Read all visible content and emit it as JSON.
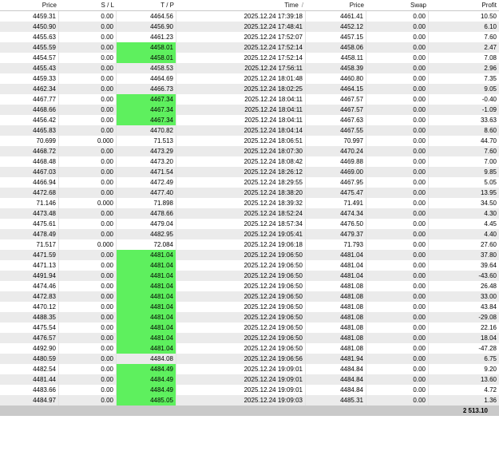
{
  "headers": {
    "price_open": "Price",
    "sl": "S / L",
    "tp": "T / P",
    "time": "Time",
    "time_sort": "/",
    "price_cur": "Price",
    "swap": "Swap",
    "profit": "Profit"
  },
  "rows": [
    {
      "p1": "4459.31",
      "sl": "0.00",
      "tp": "4464.56",
      "hl": false,
      "time": "2025.12.24 17:39:18",
      "p2": "4461.41",
      "swap": "0.00",
      "profit": "10.50"
    },
    {
      "p1": "4450.90",
      "sl": "0.00",
      "tp": "4456.90",
      "hl": false,
      "time": "2025.12.24 17:48:41",
      "p2": "4452.12",
      "swap": "0.00",
      "profit": "6.10"
    },
    {
      "p1": "4455.63",
      "sl": "0.00",
      "tp": "4461.23",
      "hl": false,
      "time": "2025.12.24 17:52:07",
      "p2": "4457.15",
      "swap": "0.00",
      "profit": "7.60"
    },
    {
      "p1": "4455.59",
      "sl": "0.00",
      "tp": "4458.01",
      "hl": true,
      "time": "2025.12.24 17:52:14",
      "p2": "4458.06",
      "swap": "0.00",
      "profit": "2.47"
    },
    {
      "p1": "4454.57",
      "sl": "0.00",
      "tp": "4458.01",
      "hl": true,
      "time": "2025.12.24 17:52:14",
      "p2": "4458.11",
      "swap": "0.00",
      "profit": "7.08"
    },
    {
      "p1": "4455.43",
      "sl": "0.00",
      "tp": "4458.53",
      "hl": false,
      "time": "2025.12.24 17:56:11",
      "p2": "4458.39",
      "swap": "0.00",
      "profit": "2.96"
    },
    {
      "p1": "4459.33",
      "sl": "0.00",
      "tp": "4464.69",
      "hl": false,
      "time": "2025.12.24 18:01:48",
      "p2": "4460.80",
      "swap": "0.00",
      "profit": "7.35"
    },
    {
      "p1": "4462.34",
      "sl": "0.00",
      "tp": "4466.73",
      "hl": false,
      "time": "2025.12.24 18:02:25",
      "p2": "4464.15",
      "swap": "0.00",
      "profit": "9.05"
    },
    {
      "p1": "4467.77",
      "sl": "0.00",
      "tp": "4467.34",
      "hl": true,
      "time": "2025.12.24 18:04:11",
      "p2": "4467.57",
      "swap": "0.00",
      "profit": "-0.40"
    },
    {
      "p1": "4468.66",
      "sl": "0.00",
      "tp": "4467.34",
      "hl": true,
      "time": "2025.12.24 18:04:11",
      "p2": "4467.57",
      "swap": "0.00",
      "profit": "-1.09"
    },
    {
      "p1": "4456.42",
      "sl": "0.00",
      "tp": "4467.34",
      "hl": true,
      "time": "2025.12.24 18:04:11",
      "p2": "4467.63",
      "swap": "0.00",
      "profit": "33.63"
    },
    {
      "p1": "4465.83",
      "sl": "0.00",
      "tp": "4470.82",
      "hl": false,
      "time": "2025.12.24 18:04:14",
      "p2": "4467.55",
      "swap": "0.00",
      "profit": "8.60"
    },
    {
      "p1": "70.699",
      "sl": "0.000",
      "tp": "71.513",
      "hl": false,
      "time": "2025.12.24 18:06:51",
      "p2": "70.997",
      "swap": "0.00",
      "profit": "44.70"
    },
    {
      "p1": "4468.72",
      "sl": "0.00",
      "tp": "4473.29",
      "hl": false,
      "time": "2025.12.24 18:07:30",
      "p2": "4470.24",
      "swap": "0.00",
      "profit": "7.60"
    },
    {
      "p1": "4468.48",
      "sl": "0.00",
      "tp": "4473.20",
      "hl": false,
      "time": "2025.12.24 18:08:42",
      "p2": "4469.88",
      "swap": "0.00",
      "profit": "7.00"
    },
    {
      "p1": "4467.03",
      "sl": "0.00",
      "tp": "4471.54",
      "hl": false,
      "time": "2025.12.24 18:26:12",
      "p2": "4469.00",
      "swap": "0.00",
      "profit": "9.85"
    },
    {
      "p1": "4466.94",
      "sl": "0.00",
      "tp": "4472.49",
      "hl": false,
      "time": "2025.12.24 18:29:55",
      "p2": "4467.95",
      "swap": "0.00",
      "profit": "5.05"
    },
    {
      "p1": "4472.68",
      "sl": "0.00",
      "tp": "4477.40",
      "hl": false,
      "time": "2025.12.24 18:38:20",
      "p2": "4475.47",
      "swap": "0.00",
      "profit": "13.95"
    },
    {
      "p1": "71.146",
      "sl": "0.000",
      "tp": "71.898",
      "hl": false,
      "time": "2025.12.24 18:39:32",
      "p2": "71.491",
      "swap": "0.00",
      "profit": "34.50"
    },
    {
      "p1": "4473.48",
      "sl": "0.00",
      "tp": "4478.66",
      "hl": false,
      "time": "2025.12.24 18:52:24",
      "p2": "4474.34",
      "swap": "0.00",
      "profit": "4.30"
    },
    {
      "p1": "4475.61",
      "sl": "0.00",
      "tp": "4479.04",
      "hl": false,
      "time": "2025.12.24 18:57:34",
      "p2": "4476.50",
      "swap": "0.00",
      "profit": "4.45"
    },
    {
      "p1": "4478.49",
      "sl": "0.00",
      "tp": "4482.95",
      "hl": false,
      "time": "2025.12.24 19:05:41",
      "p2": "4479.37",
      "swap": "0.00",
      "profit": "4.40"
    },
    {
      "p1": "71.517",
      "sl": "0.000",
      "tp": "72.084",
      "hl": false,
      "time": "2025.12.24 19:06:18",
      "p2": "71.793",
      "swap": "0.00",
      "profit": "27.60"
    },
    {
      "p1": "4471.59",
      "sl": "0.00",
      "tp": "4481.04",
      "hl": true,
      "time": "2025.12.24 19:06:50",
      "p2": "4481.04",
      "swap": "0.00",
      "profit": "37.80"
    },
    {
      "p1": "4471.13",
      "sl": "0.00",
      "tp": "4481.04",
      "hl": true,
      "time": "2025.12.24 19:06:50",
      "p2": "4481.04",
      "swap": "0.00",
      "profit": "39.64"
    },
    {
      "p1": "4491.94",
      "sl": "0.00",
      "tp": "4481.04",
      "hl": true,
      "time": "2025.12.24 19:06:50",
      "p2": "4481.04",
      "swap": "0.00",
      "profit": "-43.60"
    },
    {
      "p1": "4474.46",
      "sl": "0.00",
      "tp": "4481.04",
      "hl": true,
      "time": "2025.12.24 19:06:50",
      "p2": "4481.08",
      "swap": "0.00",
      "profit": "26.48"
    },
    {
      "p1": "4472.83",
      "sl": "0.00",
      "tp": "4481.04",
      "hl": true,
      "time": "2025.12.24 19:06:50",
      "p2": "4481.08",
      "swap": "0.00",
      "profit": "33.00"
    },
    {
      "p1": "4470.12",
      "sl": "0.00",
      "tp": "4481.04",
      "hl": true,
      "time": "2025.12.24 19:06:50",
      "p2": "4481.08",
      "swap": "0.00",
      "profit": "43.84"
    },
    {
      "p1": "4488.35",
      "sl": "0.00",
      "tp": "4481.04",
      "hl": true,
      "time": "2025.12.24 19:06:50",
      "p2": "4481.08",
      "swap": "0.00",
      "profit": "-29.08"
    },
    {
      "p1": "4475.54",
      "sl": "0.00",
      "tp": "4481.04",
      "hl": true,
      "time": "2025.12.24 19:06:50",
      "p2": "4481.08",
      "swap": "0.00",
      "profit": "22.16"
    },
    {
      "p1": "4476.57",
      "sl": "0.00",
      "tp": "4481.04",
      "hl": true,
      "time": "2025.12.24 19:06:50",
      "p2": "4481.08",
      "swap": "0.00",
      "profit": "18.04"
    },
    {
      "p1": "4492.90",
      "sl": "0.00",
      "tp": "4481.04",
      "hl": true,
      "time": "2025.12.24 19:06:50",
      "p2": "4481.08",
      "swap": "0.00",
      "profit": "-47.28"
    },
    {
      "p1": "4480.59",
      "sl": "0.00",
      "tp": "4484.08",
      "hl": false,
      "time": "2025.12.24 19:06:56",
      "p2": "4481.94",
      "swap": "0.00",
      "profit": "6.75"
    },
    {
      "p1": "4482.54",
      "sl": "0.00",
      "tp": "4484.49",
      "hl": true,
      "time": "2025.12.24 19:09:01",
      "p2": "4484.84",
      "swap": "0.00",
      "profit": "9.20"
    },
    {
      "p1": "4481.44",
      "sl": "0.00",
      "tp": "4484.49",
      "hl": true,
      "time": "2025.12.24 19:09:01",
      "p2": "4484.84",
      "swap": "0.00",
      "profit": "13.60"
    },
    {
      "p1": "4483.66",
      "sl": "0.00",
      "tp": "4484.49",
      "hl": true,
      "time": "2025.12.24 19:09:01",
      "p2": "4484.84",
      "swap": "0.00",
      "profit": "4.72"
    },
    {
      "p1": "4484.97",
      "sl": "0.00",
      "tp": "4485.05",
      "hl": true,
      "time": "2025.12.24 19:09:03",
      "p2": "4485.31",
      "swap": "0.00",
      "profit": "1.36"
    }
  ],
  "total_profit": "2 513.10",
  "colors": {
    "tp_highlight": "#5ef05e",
    "alt_row": "#ebebeb",
    "footer_bg": "#c9c9c9"
  }
}
